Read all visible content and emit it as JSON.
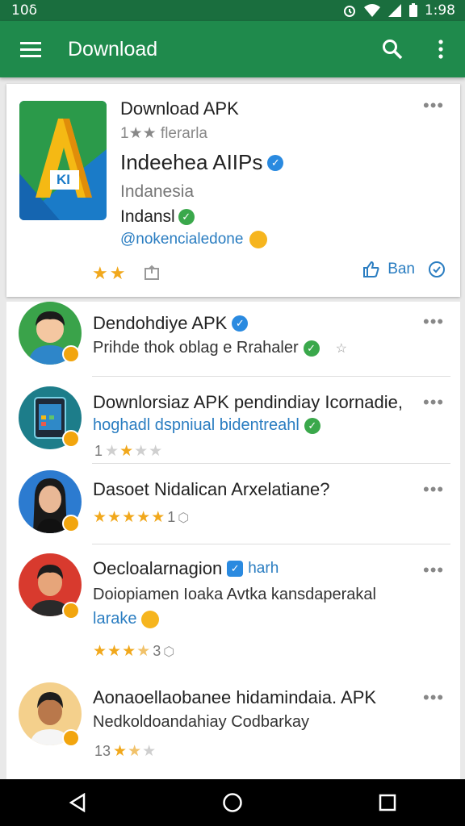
{
  "status": {
    "left": "10δ",
    "time": "1:98"
  },
  "toolbar": {
    "title": "Download"
  },
  "featured": {
    "title": "Download APK",
    "subtitle": "1★★ flerarla",
    "heading": "Indeehea AIIPs",
    "country": "Indanesia",
    "region": "Indansl",
    "handle": "@nokencialedone",
    "rating_stars": 2,
    "action_label": "Ban",
    "logo_text": "KI"
  },
  "items": [
    {
      "title": "Dendohdiye APK",
      "subtitle": "Prihde thok oblag e Rrahaler",
      "subtitle_blue": false,
      "stars": null
    },
    {
      "title": "Downlorsiaz APK pendindiay Icornadie,",
      "subtitle": "hoghadl dspniual bidentreahl",
      "subtitle_blue": true,
      "rating_prefix": "1",
      "stars": 2
    },
    {
      "title": "Dasoet Nidalican Arxelatiane?",
      "subtitle": "",
      "stars": 5,
      "rating_suffix": "1"
    },
    {
      "title": "Oecloalarnagion",
      "title_tag": "harh",
      "subtitle": "Doiopiamen Ioaka Avtka kansdaperakal",
      "subtitle2": "larake",
      "stars": 3.5,
      "rating_suffix": "3"
    },
    {
      "title": "Aonaoellaobanee hidamindaia. APK",
      "subtitle": "Nedkoldoandahiay Codbarkay",
      "rating_prefix": "13",
      "stars": 1.5
    }
  ]
}
